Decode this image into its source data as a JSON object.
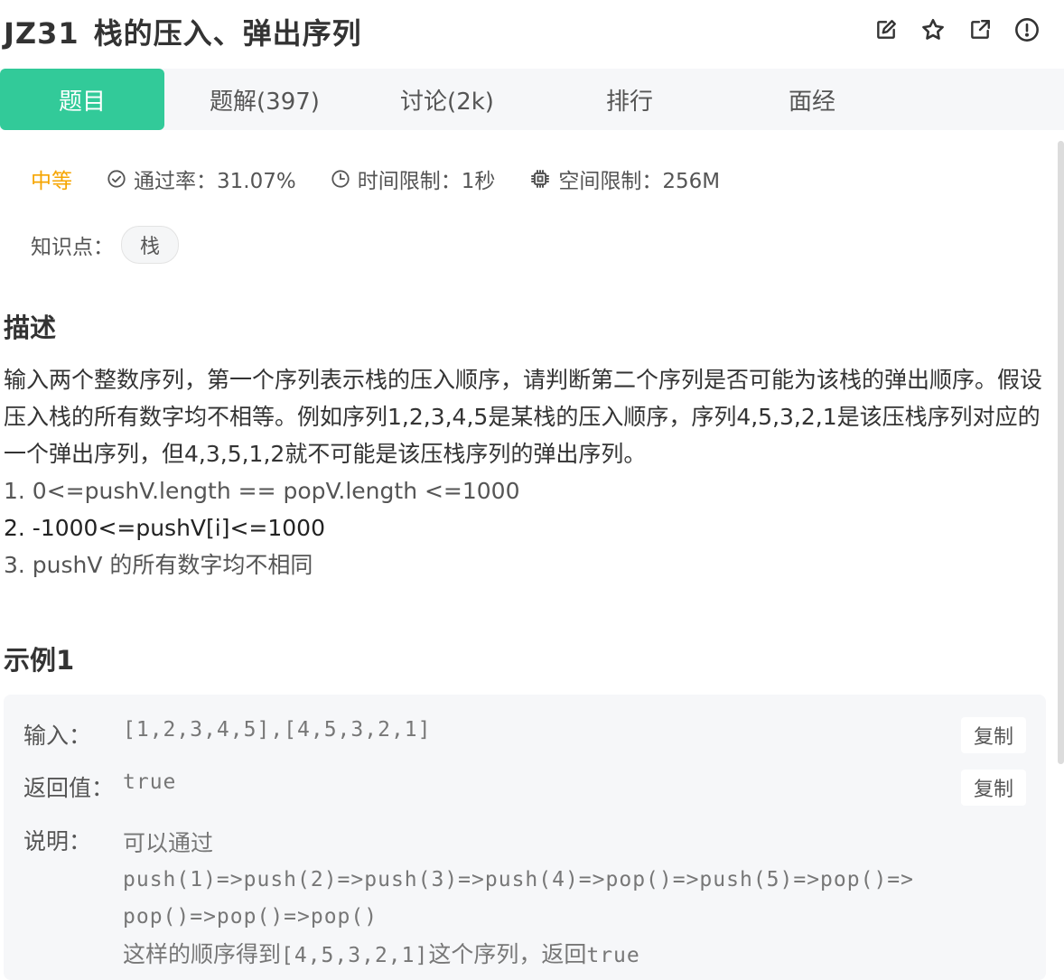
{
  "problem": {
    "code": "JZ31",
    "title": "栈的压入、弹出序列"
  },
  "header_icons": [
    "edit-icon",
    "star-icon",
    "external-link-icon",
    "report-icon"
  ],
  "tabs": [
    {
      "label": "题目",
      "active": true
    },
    {
      "label": "题解(397)",
      "active": false
    },
    {
      "label": "讨论(2k)",
      "active": false
    },
    {
      "label": "排行",
      "active": false
    },
    {
      "label": "面经",
      "active": false
    }
  ],
  "meta": {
    "difficulty": "中等",
    "pass_rate": "通过率：31.07%",
    "time_limit": "时间限制：1秒",
    "space_limit": "空间限制：256M"
  },
  "knowledge": {
    "label": "知识点：",
    "tag": "栈"
  },
  "description": {
    "heading": "描述",
    "paragraph": "输入两个整数序列，第一个序列表示栈的压入顺序，请判断第二个序列是否可能为该栈的弹出顺序。假设压入栈的所有数字均不相等。例如序列1,2,3,4,5是某栈的压入顺序，序列4,5,3,2,1是该压栈序列对应的一个弹出序列，但4,3,5,1,2就不可能是该压栈序列的弹出序列。",
    "constraints": [
      "1. 0<=pushV.length == popV.length <=1000",
      "2. -1000<=pushV[i]<=1000",
      "3. pushV 的所有数字均不相同"
    ]
  },
  "example": {
    "heading": "示例1",
    "input_label": "输入：",
    "input_value": "[1,2,3,4,5],[4,5,3,2,1]",
    "return_label": "返回值：",
    "return_value": "true",
    "explain_label": "说明：",
    "explain_line1": "可以通过",
    "explain_line2": "push(1)=>push(2)=>push(3)=>push(4)=>pop()=>push(5)=>pop()=>",
    "explain_line3": "pop()=>pop()=>pop()",
    "explain_line4_prefix": "这样的顺序得到",
    "explain_line4_mono1": "[4,5,3,2,1]",
    "explain_line4_mid": "这个序列，返回",
    "explain_line4_mono2": "true",
    "copy_label": "复制"
  },
  "colors": {
    "accent": "#32ca99",
    "difficulty": "#f6a500",
    "tab_bg": "#f6f7f9"
  }
}
